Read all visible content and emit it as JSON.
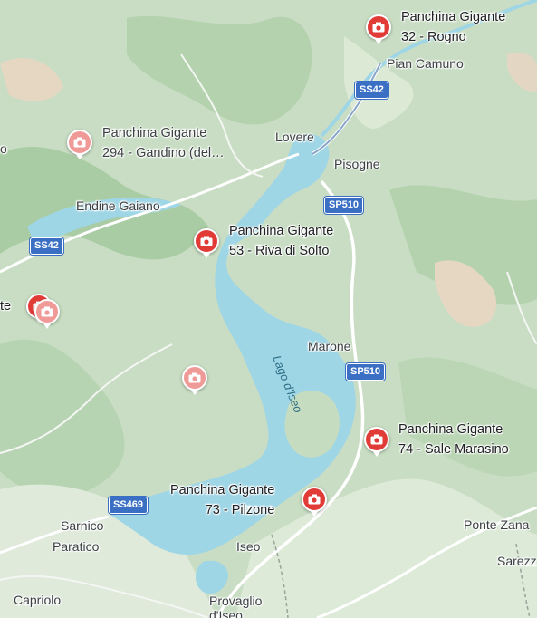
{
  "map": {
    "lake_label": "Lago d'Iseo",
    "towns": {
      "pian_camuno": "Pian Camuno",
      "lovere": "Lovere",
      "pisogne": "Pisogne",
      "endine_gaiano": "Endine Gaiano",
      "marone": "Marone",
      "sarnico": "Sarnico",
      "paratico": "Paratico",
      "iseo": "Iseo",
      "capriolo": "Capriolo",
      "provaglio": "Provaglio d'Iseo",
      "ponte_zanano": "Ponte Zana",
      "sarezzo": "Sarezz",
      "edge_left_o": "o",
      "edge_left_te": "te"
    },
    "roads": {
      "ss42_north": "SS42",
      "ss42_west": "SS42",
      "sp510_north": "SP510",
      "sp510_south": "SP510",
      "ss469": "SS469"
    },
    "pois": [
      {
        "id": "rogno",
        "line1": "Panchina Gigante",
        "line2": "32 - Rogno",
        "style": "red",
        "icon": "camera-icon"
      },
      {
        "id": "gandino",
        "line1": "Panchina Gigante",
        "line2": "294 - Gandino (del…",
        "style": "pink",
        "icon": "camera-icon"
      },
      {
        "id": "riva",
        "line1": "Panchina Gigante",
        "line2": "53 - Riva di Solto",
        "style": "red",
        "icon": "camera-icon"
      },
      {
        "id": "marasino",
        "line1": "Panchina Gigante",
        "line2": "74 - Sale Marasino",
        "style": "red",
        "icon": "camera-icon"
      },
      {
        "id": "pilzone",
        "line1": "Panchina Gigante",
        "line2": "73 - Pilzone",
        "style": "red",
        "icon": "camera-icon"
      },
      {
        "id": "west_red",
        "style": "red",
        "icon": "camera-icon"
      },
      {
        "id": "west_pink",
        "style": "pink",
        "icon": "camera-icon"
      },
      {
        "id": "center_pink",
        "style": "pink",
        "icon": "camera-icon"
      }
    ],
    "colors": {
      "water": "#9fd6e6",
      "land": "#c6dcc0",
      "terrain": "#e6d7c3",
      "pin_red": "#e03b37",
      "pin_pink": "#f09a97",
      "road_shield": "#3a6fc4"
    }
  }
}
